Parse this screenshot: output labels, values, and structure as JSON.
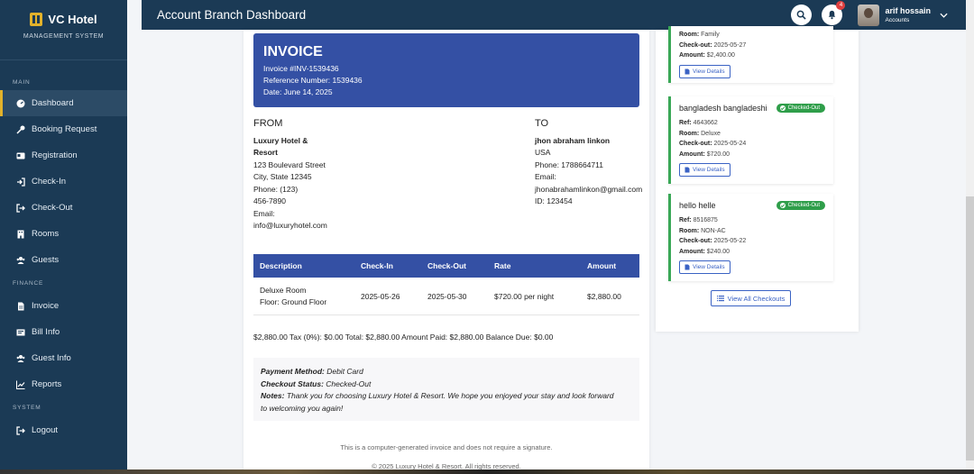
{
  "brand": {
    "title": "VC Hotel",
    "subtitle": "MANAGEMENT SYSTEM"
  },
  "sidebar": {
    "sections": [
      {
        "label": "MAIN",
        "items": [
          {
            "label": "Dashboard",
            "icon": "dashboard-icon",
            "active": true
          },
          {
            "label": "Booking Request",
            "icon": "key-icon"
          },
          {
            "label": "Registration",
            "icon": "id-card-icon"
          },
          {
            "label": "Check-In",
            "icon": "sign-in-icon"
          },
          {
            "label": "Check-Out",
            "icon": "sign-out-icon"
          },
          {
            "label": "Rooms",
            "icon": "building-icon"
          },
          {
            "label": "Guests",
            "icon": "users-icon"
          }
        ]
      },
      {
        "label": "FINANCE",
        "items": [
          {
            "label": "Invoice",
            "icon": "file-invoice-icon"
          },
          {
            "label": "Bill Info",
            "icon": "receipt-icon"
          },
          {
            "label": "Guest Info",
            "icon": "users-icon"
          },
          {
            "label": "Reports",
            "icon": "chart-line-icon"
          }
        ]
      },
      {
        "label": "SYSTEM",
        "items": [
          {
            "label": "Logout",
            "icon": "logout-icon"
          }
        ]
      }
    ]
  },
  "header": {
    "title": "Account Branch Dashboard",
    "notification_count": "4",
    "user_name": "arif hossain",
    "user_role": "Accounts"
  },
  "invoice": {
    "title": "INVOICE",
    "number": "Invoice #INV-1539436",
    "reference": "Reference Number: 1539436",
    "date": "Date: June 14, 2025",
    "from": {
      "heading": "FROM",
      "name_1": "Luxury Hotel &",
      "name_2": "Resort",
      "address_1": "123 Boulevard Street",
      "address_2": "City, State 12345",
      "phone_1": "Phone: (123)",
      "phone_2": "456-7890",
      "email_label": "Email:",
      "email": "info@luxuryhotel.com"
    },
    "to": {
      "heading": "TO",
      "name": "jhon abraham linkon",
      "country": "USA",
      "phone": "Phone: 1788664711",
      "email_label": "Email:",
      "email": "jhonabrahamlinkon@gmail.com",
      "id": "ID: 123454"
    },
    "table": {
      "headers": [
        "Description",
        "Check-In",
        "Check-Out",
        "Rate",
        "Amount"
      ],
      "row": {
        "description_1": "Deluxe Room",
        "description_2": "Floor: Ground Floor",
        "check_in": "2025-05-26",
        "check_out": "2025-05-30",
        "rate": "$720.00 per night",
        "amount": "$2,880.00"
      }
    },
    "totals": "$2,880.00 Tax (0%): $0.00 Total: $2,880.00 Amount Paid: $2,880.00 Balance Due: $0.00",
    "payment": {
      "method_label": "Payment Method:",
      "method": "Debit Card",
      "status_label": "Checkout Status:",
      "status": "Checked-Out",
      "notes_label": "Notes:",
      "notes_1": "Thank you for choosing Luxury Hotel & Resort. We hope you enjoyed your stay and look forward",
      "notes_2": "to welcoming you again!"
    },
    "footer_note": "This is a computer-generated invoice and does not require a signature.",
    "copyright": "© 2025 Luxury Hotel & Resort. All rights reserved."
  },
  "checkouts": {
    "labels": {
      "ref": "Ref:",
      "room": "Room:",
      "checkout": "Check-out:",
      "amount": "Amount:"
    },
    "status_badge": "Checked-Out",
    "view_details": "View Details",
    "view_all": "View All Checkouts",
    "partial_item": {
      "room": "Family",
      "checkout": "2025-05-27",
      "amount": "$2,400.00"
    },
    "items": [
      {
        "name": "bangladesh bangladeshi",
        "ref": "4643662",
        "room": "Deluxe",
        "checkout": "2025-05-24",
        "amount": "$720.00"
      },
      {
        "name": "hello helle",
        "ref": "8516875",
        "room": "NON-AC",
        "checkout": "2025-05-22",
        "amount": "$240.00"
      }
    ]
  },
  "colors": {
    "sidebar": "#1b3a55",
    "accent": "#3450a4",
    "success": "#2f9e4a",
    "active_marker": "#e2b22b"
  }
}
